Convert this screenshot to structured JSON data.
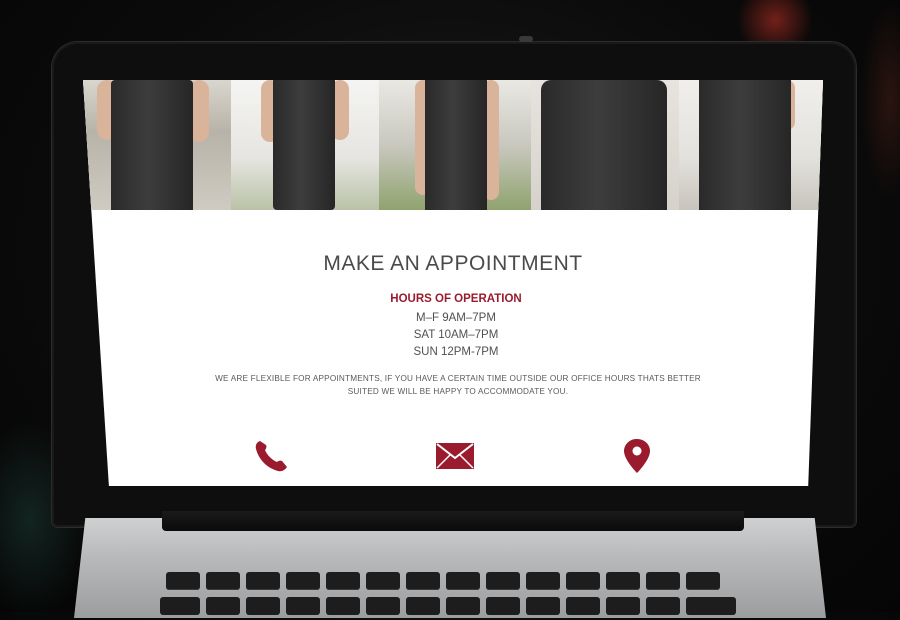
{
  "page": {
    "title": "MAKE AN APPOINTMENT",
    "hours_heading": "HOURS OF OPERATION",
    "hours": [
      "M–F 9AM–7PM",
      "SAT 10AM–7PM",
      "SUN 12PM-7PM"
    ],
    "note_line1": "WE ARE FLEXIBLE FOR APPOINTMENTS, IF YOU HAVE A CERTAIN TIME OUTSIDE OUR OFFICE HOURS THATS BETTER",
    "note_line2": "SUITED WE WILL BE HAPPY TO ACCOMMODATE YOU."
  },
  "contact_icons": [
    {
      "name": "phone-icon"
    },
    {
      "name": "envelope-icon"
    },
    {
      "name": "map-pin-icon"
    }
  ],
  "colors": {
    "accent": "#9b1b2e",
    "text": "#4a4a4a"
  }
}
